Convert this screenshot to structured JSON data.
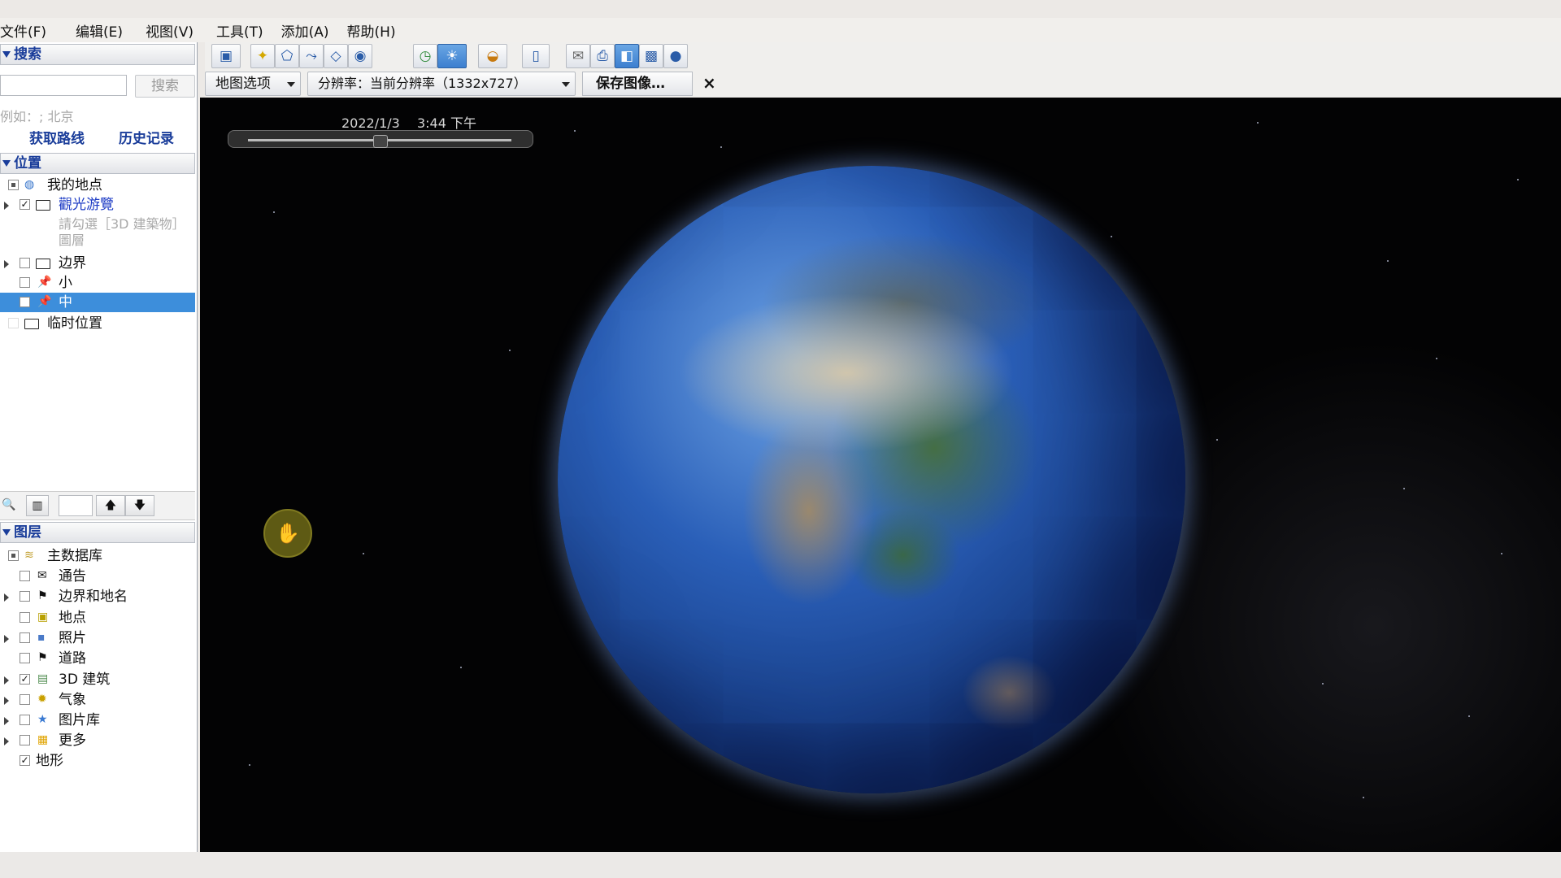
{
  "menu": [
    "文件(F)",
    "编辑(E)",
    "视图(V)",
    "工具(T)",
    "添加(A)",
    "帮助(H)"
  ],
  "search": {
    "header": "搜索",
    "button": "搜索",
    "hint": "例如：; 北京",
    "links": [
      "获取路线",
      "历史记录"
    ]
  },
  "places": {
    "header": "位置",
    "items": [
      {
        "label": "我的地点",
        "icon": "globe-icon"
      },
      {
        "label": "觀光游覽",
        "icon": "folder-icon",
        "checked": true
      },
      {
        "label": "請勾選［3D 建築物］圖層"
      },
      {
        "label": "边界",
        "icon": "folder-icon"
      },
      {
        "label": "小",
        "icon": "pushpin-icon"
      },
      {
        "label": "中",
        "icon": "pushpin-icon",
        "selected": true
      },
      {
        "label": "临时位置",
        "icon": "folder-icon"
      }
    ]
  },
  "layers": {
    "header": "图层",
    "items": [
      {
        "label": "主数据库",
        "icon": "database-icon"
      },
      {
        "label": "通告",
        "icon": "envelope-icon"
      },
      {
        "label": "边界和地名",
        "icon": "flag-icon"
      },
      {
        "label": "地点",
        "icon": "place-icon"
      },
      {
        "label": "照片",
        "icon": "photo-icon"
      },
      {
        "label": "道路",
        "icon": "road-icon"
      },
      {
        "label": "3D 建筑",
        "icon": "building-icon",
        "checked": true
      },
      {
        "label": "气象",
        "icon": "weather-icon"
      },
      {
        "label": "图片库",
        "icon": "gallery-icon"
      },
      {
        "label": "更多",
        "icon": "more-icon"
      },
      {
        "label": "地形",
        "checked": true
      }
    ]
  },
  "toolbar2": {
    "map_options": "地图选项",
    "resolution": "分辨率：当前分辨率（1332x727）",
    "save_image": "保存图像…",
    "close": "×"
  },
  "viewport": {
    "timestamp": "2022/1/3　 3:44 下午",
    "timeline_position": 0.5
  },
  "colors": {
    "selection": "#3d8edb",
    "header_text": "#1a3d9a",
    "space": "#030304"
  }
}
